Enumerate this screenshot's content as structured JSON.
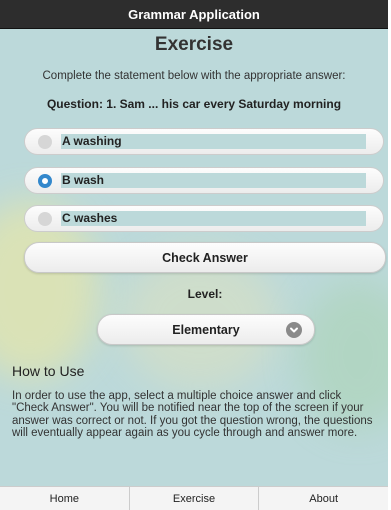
{
  "header": {
    "title": "Grammar Application"
  },
  "page": {
    "title": "Exercise",
    "instruction": "Complete the statement below with the appropriate answer:",
    "question": "Question: 1. Sam ... his car every Saturday morning"
  },
  "options": [
    {
      "label": "A washing",
      "selected": false
    },
    {
      "label": "B wash",
      "selected": true
    },
    {
      "label": "C washes",
      "selected": false
    }
  ],
  "check_button": {
    "label": "Check Answer"
  },
  "level": {
    "label": "Level:",
    "selected": "Elementary"
  },
  "how_to_use": {
    "title": "How to Use",
    "text": "In order to use the app, select a multiple choice answer and click \"Check Answer\". You will be notified near the top of the screen if your answer was correct or not. If you got the question wrong, the questions will eventually appear again as you cycle through and answer more."
  },
  "footer": {
    "tabs": [
      "Home",
      "Exercise",
      "About"
    ]
  },
  "colors": {
    "background": "#bcd9da",
    "header": "#2d2d2d",
    "radio_selected": "#3388cc"
  }
}
